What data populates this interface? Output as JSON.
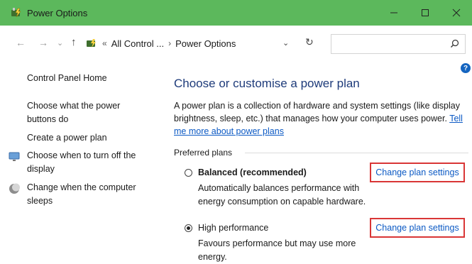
{
  "window": {
    "title": "Power Options",
    "accent": "#5cb85c",
    "controls": {
      "minimize": "minimize-icon",
      "maximize": "maximize-icon",
      "close": "close-icon"
    }
  },
  "address": {
    "crumb_ellipsis": "All Control ...",
    "crumb_current": "Power Options",
    "search_placeholder": ""
  },
  "sidebar": {
    "home": "Control Panel Home",
    "items": [
      {
        "label": "Choose what the power buttons do",
        "icon": null
      },
      {
        "label": "Create a power plan",
        "icon": null
      },
      {
        "label": "Choose when to turn off the display",
        "icon": "monitor-icon"
      },
      {
        "label": "Change when the computer sleeps",
        "icon": "moon-icon"
      }
    ]
  },
  "main": {
    "heading": "Choose or customise a power plan",
    "description": "A power plan is a collection of hardware and system settings (like display brightness, sleep, etc.) that manages how your computer uses power.",
    "tell_me_link": "Tell me more about power plans",
    "preferred_label": "Preferred plans",
    "plans": [
      {
        "name": "Balanced (recommended)",
        "selected": false,
        "description": "Automatically balances performance with energy consumption on capable hardware.",
        "change_link": "Change plan settings"
      },
      {
        "name": "High performance",
        "selected": true,
        "description": "Favours performance but may use more energy.",
        "change_link": "Change plan settings"
      }
    ],
    "highlight_color": "#d93636"
  }
}
